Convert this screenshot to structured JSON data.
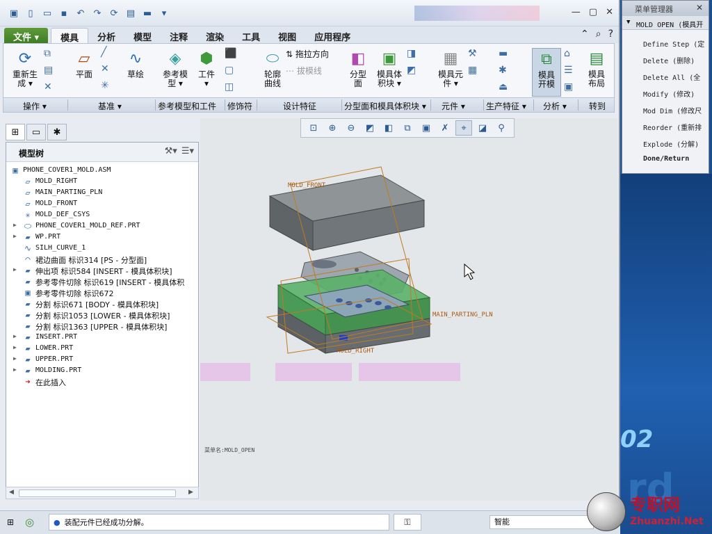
{
  "window": {
    "controls": [
      "—",
      "▢",
      "✕"
    ]
  },
  "tabs": [
    {
      "label": "文件",
      "type": "file"
    },
    {
      "label": "模具",
      "type": "active"
    },
    {
      "label": "分析"
    },
    {
      "label": "模型"
    },
    {
      "label": "注释"
    },
    {
      "label": "渲染"
    },
    {
      "label": "工具"
    },
    {
      "label": "视图"
    },
    {
      "label": "应用程序"
    }
  ],
  "ribbon": {
    "buttons": [
      {
        "label1": "重新生",
        "label2": "成 ▾",
        "icon": "regenerate-icon",
        "glyph": "⟳",
        "color": "#2a6fb5"
      },
      {
        "label1": "平面",
        "label2": "",
        "icon": "datum-plane-icon",
        "glyph": "▱",
        "color": "#b04a10"
      },
      {
        "label1": "草绘",
        "label2": "",
        "icon": "sketch-icon",
        "glyph": "∿",
        "color": "#2a6fb5"
      },
      {
        "label1": "参考模",
        "label2": "型 ▾",
        "icon": "reference-model-icon",
        "glyph": "◈",
        "color": "#3aa0a0"
      },
      {
        "label1": "工件",
        "label2": "▾",
        "icon": "workpiece-icon",
        "glyph": "⬢",
        "color": "#3e9a3a"
      },
      {
        "label1": "轮廓",
        "label2": "曲线",
        "icon": "silhouette-curve-icon",
        "glyph": "⬭",
        "color": "#4a9ab0"
      },
      {
        "label1": "分型",
        "label2": "面",
        "icon": "parting-surface-icon",
        "glyph": "◧",
        "color": "#b04ab0"
      },
      {
        "label1": "模具体",
        "label2": "积块 ▾",
        "icon": "mold-volume-icon",
        "glyph": "▣",
        "color": "#3e9a3a"
      },
      {
        "label1": "模具元",
        "label2": "件 ▾",
        "icon": "mold-component-icon",
        "glyph": "▦",
        "color": "#888888"
      },
      {
        "label1": "模具",
        "label2": "开模",
        "icon": "mold-open-icon",
        "glyph": "⧉",
        "color": "#2a8a3a",
        "active": true
      },
      {
        "label1": "模具",
        "label2": "布局",
        "icon": "mold-layout-icon",
        "glyph": "▤",
        "color": "#2a8a3a"
      }
    ],
    "small_actions": [
      {
        "label": "拖拉方向",
        "icon": "pull-direction-icon"
      },
      {
        "label": "拔模线",
        "icon": "draft-line-icon"
      }
    ],
    "groups": [
      "操作 ▾",
      "基准 ▾",
      "参考模型和工件",
      "修饰符",
      "设计特征",
      "分型面和模具体积块 ▾",
      "元件 ▾",
      "生产特征 ▾",
      "分析 ▾",
      "转到"
    ]
  },
  "model_tree": {
    "title": "模型树",
    "items": [
      {
        "label": "PHONE_COVER1_MOLD.ASM",
        "icon": "assembly-icon",
        "glyph": "▣",
        "level": 0,
        "expand": false
      },
      {
        "label": "MOLD_RIGHT",
        "icon": "datum-plane-icon",
        "glyph": "▱",
        "level": 1,
        "expand": false
      },
      {
        "label": "MAIN_PARTING_PLN",
        "icon": "datum-plane-icon",
        "glyph": "▱",
        "level": 1,
        "expand": false
      },
      {
        "label": "MOLD_FRONT",
        "icon": "datum-plane-icon",
        "glyph": "▱",
        "level": 1,
        "expand": false
      },
      {
        "label": "MOLD_DEF_CSYS",
        "icon": "csys-icon",
        "glyph": "✳",
        "level": 1,
        "expand": false
      },
      {
        "label": "PHONE_COVER1_MOLD_REF.PRT",
        "icon": "part-icon",
        "glyph": "⬭",
        "level": 1,
        "expand": true
      },
      {
        "label": "WP.PRT",
        "icon": "part-icon",
        "glyph": "▰",
        "level": 1,
        "expand": true
      },
      {
        "label": "SILH_CURVE_1",
        "icon": "curve-icon",
        "glyph": "∿",
        "level": 1,
        "expand": false
      },
      {
        "label": "裙边曲面 标识314 [PS - 分型面]",
        "icon": "surface-icon",
        "glyph": "◠",
        "level": 1,
        "expand": false,
        "cjk": true
      },
      {
        "label": "伸出项 标识584 [INSERT - 模具体积块]",
        "icon": "extrude-icon",
        "glyph": "▰",
        "level": 1,
        "expand": true,
        "cjk": true
      },
      {
        "label": "参考零件切除 标识619 [INSERT - 模具体积",
        "icon": "cut-icon",
        "glyph": "▰",
        "level": 1,
        "expand": false,
        "cjk": true
      },
      {
        "label": "参考零件切除 标识672",
        "icon": "cut-icon",
        "glyph": "▣",
        "level": 1,
        "expand": false,
        "cjk": true
      },
      {
        "label": "分割 标识671 [BODY - 模具体积块]",
        "icon": "split-icon",
        "glyph": "▰",
        "level": 1,
        "expand": false,
        "cjk": true
      },
      {
        "label": "分割 标识1053 [LOWER - 模具体积块]",
        "icon": "split-icon",
        "glyph": "▰",
        "level": 1,
        "expand": false,
        "cjk": true
      },
      {
        "label": "分割 标识1363 [UPPER - 模具体积块]",
        "icon": "split-icon",
        "glyph": "▰",
        "level": 1,
        "expand": false,
        "cjk": true
      },
      {
        "label": "INSERT.PRT",
        "icon": "part-icon",
        "glyph": "▰",
        "level": 1,
        "expand": true
      },
      {
        "label": "LOWER.PRT",
        "icon": "part-icon",
        "glyph": "▰",
        "level": 1,
        "expand": true
      },
      {
        "label": "UPPER.PRT",
        "icon": "part-icon",
        "glyph": "▰",
        "level": 1,
        "expand": true
      },
      {
        "label": "MOLDING.PRT",
        "icon": "part-icon",
        "glyph": "▰",
        "level": 1,
        "expand": true
      },
      {
        "label": "在此插入",
        "icon": "insert-here-icon",
        "glyph": "➜",
        "level": 1,
        "expand": false,
        "cjk": true,
        "red": true
      }
    ]
  },
  "graphics": {
    "labels": {
      "mold_front": "MOLD_FRONT",
      "main_parting": "MAIN_PARTING_PLN",
      "mold_right": "MOLD_RIGHT",
      "menu_name": "菜单名:MOLD_OPEN"
    },
    "colors": {
      "workpiece": "#6a8a7a",
      "part_green": "#55b06a",
      "plane": "#c07a20"
    }
  },
  "status": {
    "message": "装配元件已经成功分解。",
    "filter": "智能"
  },
  "menu_manager": {
    "title": "菜单管理器",
    "header": "MOLD OPEN (模具开",
    "items": [
      {
        "label": "Define Step (定",
        "bold": false
      },
      {
        "label": "Delete (删除)",
        "bold": false
      },
      {
        "label": "Delete All (全",
        "bold": false
      },
      {
        "label": "Modify (修改)",
        "bold": false
      },
      {
        "label": "Mod Dim (修改尺",
        "bold": false
      },
      {
        "label": "Reorder (重新排",
        "bold": false
      },
      {
        "label": "Explode (分解)",
        "bold": false
      },
      {
        "label": "Done/Return",
        "bold": true
      }
    ]
  },
  "watermark": {
    "cn": "专职网",
    "en": "Zhuanzhi.Net",
    "backdrop": "02"
  }
}
